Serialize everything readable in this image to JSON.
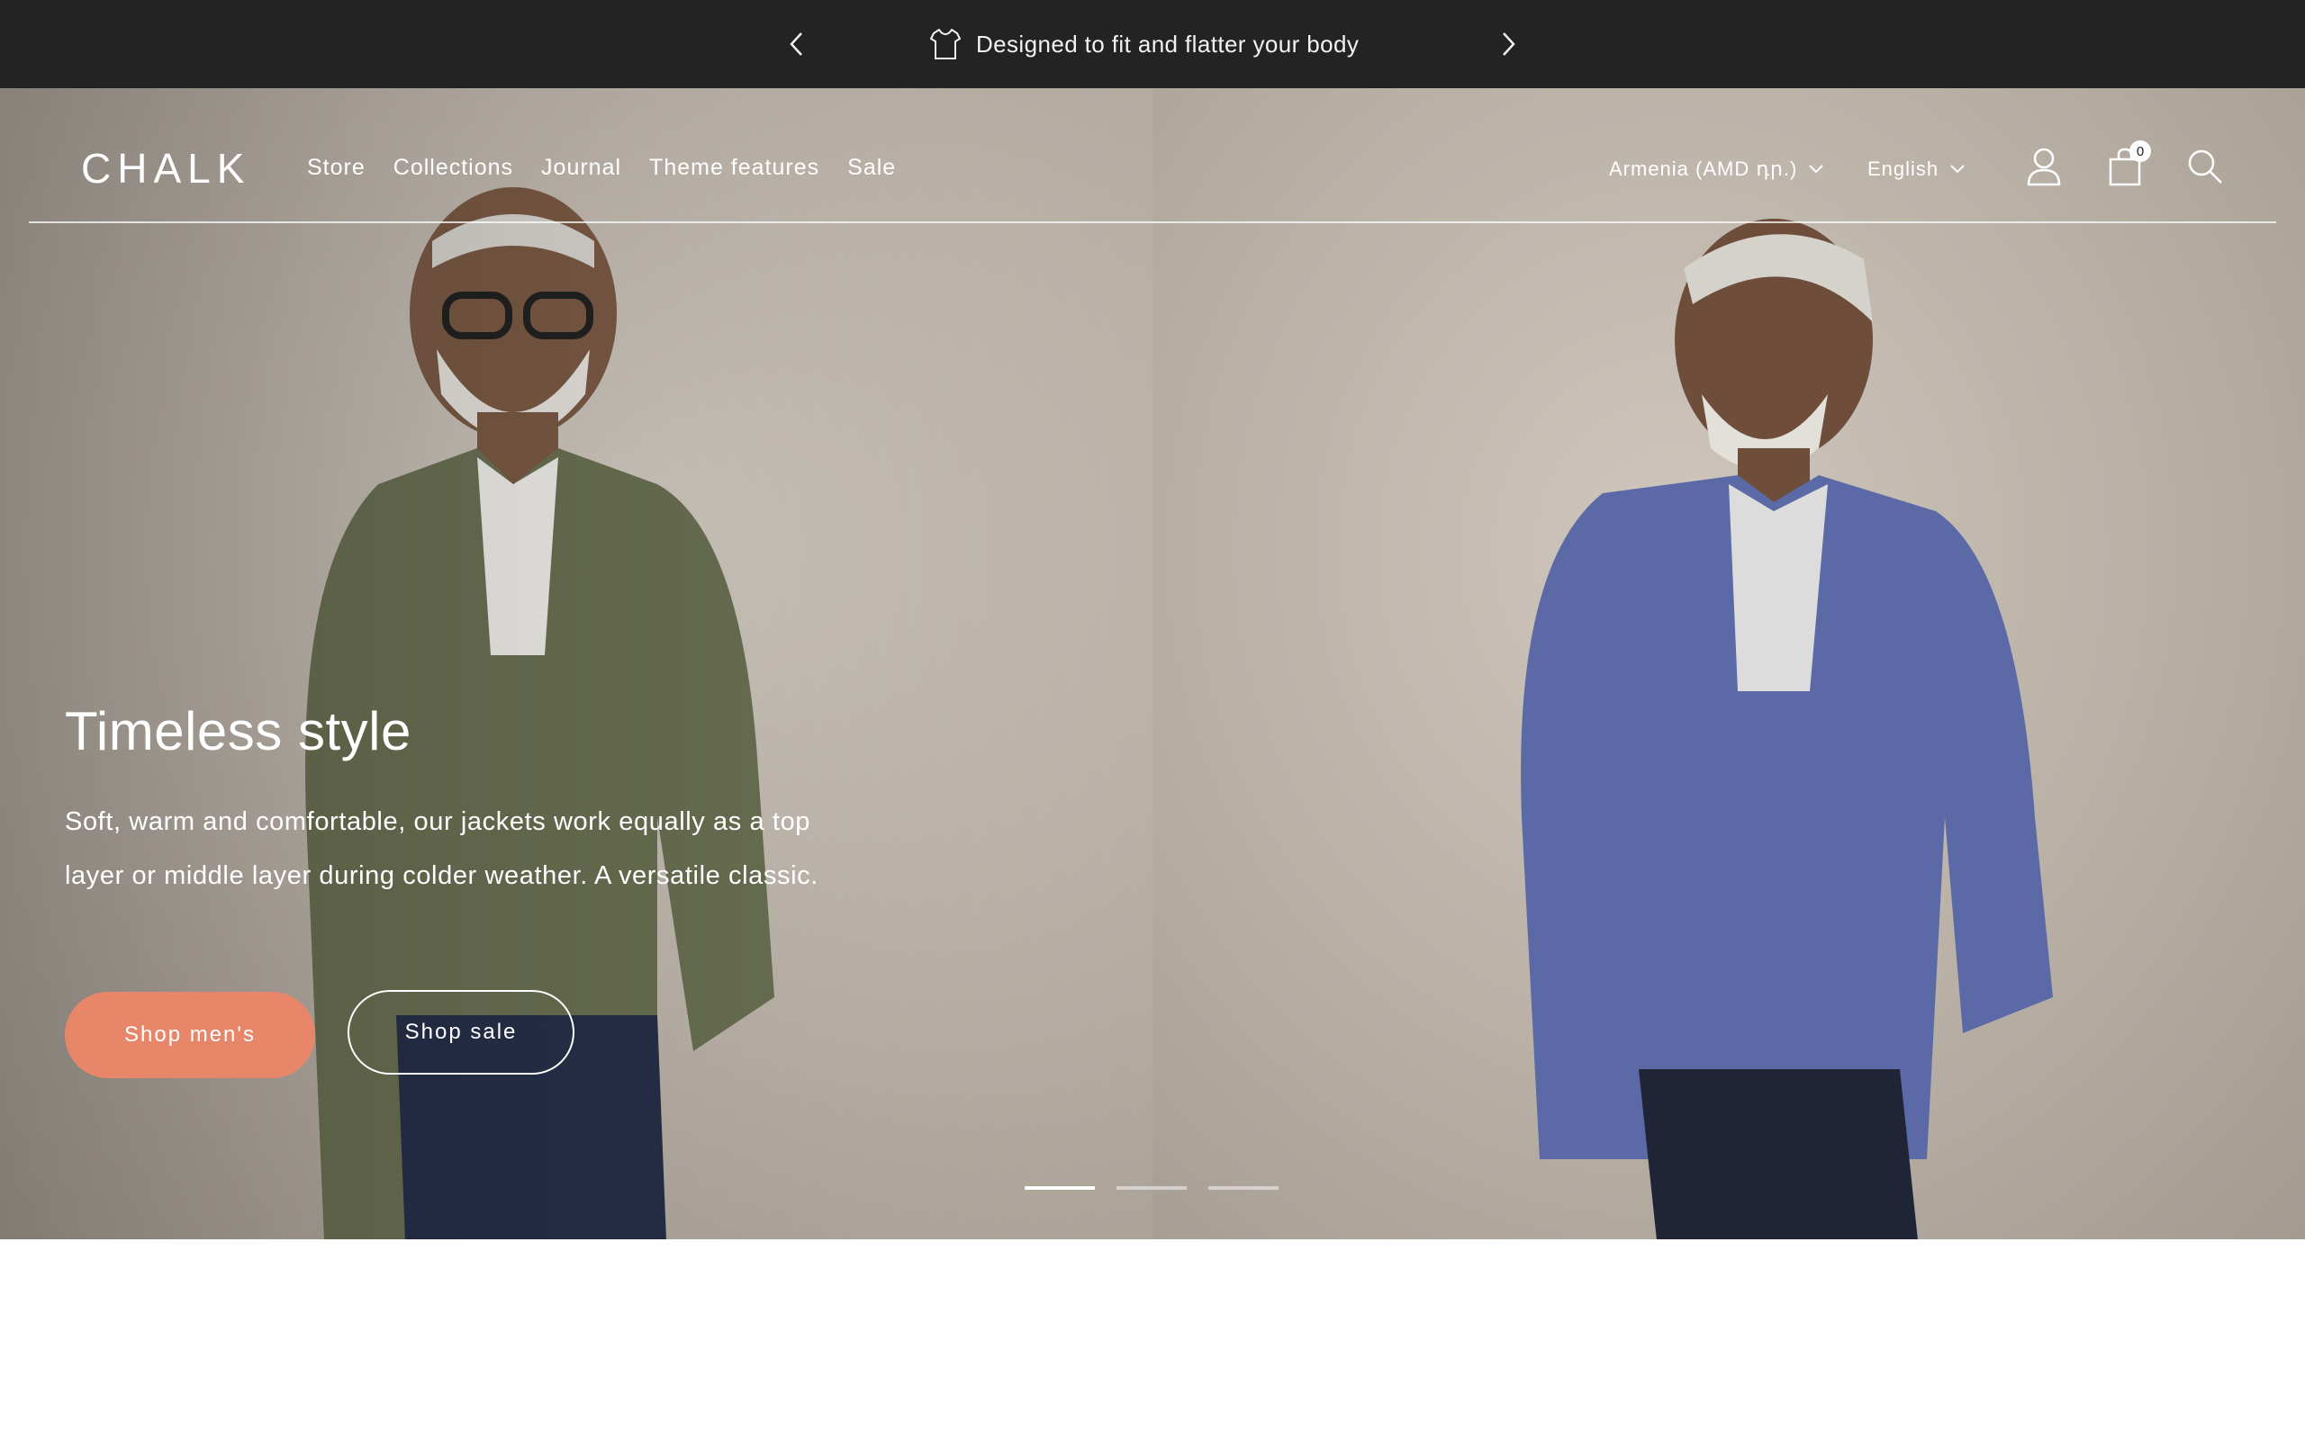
{
  "announcement": {
    "message": "Designed to fit and flatter your body",
    "icon": "shirt-icon",
    "prev_icon": "chevron-left-icon",
    "next_icon": "chevron-right-icon"
  },
  "header": {
    "logo": "CHALK",
    "nav": [
      {
        "label": "Store"
      },
      {
        "label": "Collections"
      },
      {
        "label": "Journal"
      },
      {
        "label": "Theme features"
      },
      {
        "label": "Sale"
      }
    ],
    "country_selector": "Armenia (AMD դր.)",
    "language_selector": "English",
    "cart_count": "0"
  },
  "hero": {
    "title": "Timeless style",
    "body": "Soft, warm and comfortable, our jackets work equally as a top layer or middle layer during colder weather. A versatile classic.",
    "primary_button": "Shop men's",
    "secondary_button": "Shop sale",
    "slide_count": 3,
    "active_slide": 1
  },
  "colors": {
    "announcement_bg": "#232323",
    "accent_button": "#e8866a",
    "text_on_hero": "#ffffff"
  }
}
